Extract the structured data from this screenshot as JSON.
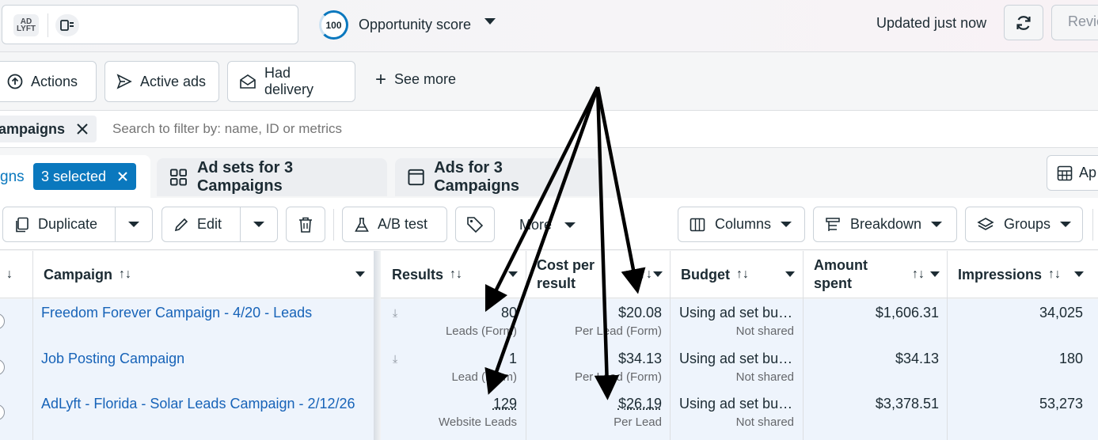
{
  "header": {
    "account_logo_text": "AD LYFT",
    "score_value": "100",
    "score_label": "Opportunity score",
    "updated_text": "Updated just now",
    "review_label": "Revie"
  },
  "filters": {
    "actions": "Actions",
    "active_ads": "Active ads",
    "had_delivery": "Had delivery",
    "see_more": "See more"
  },
  "search": {
    "chip_label": "ampaigns",
    "placeholder": "Search to filter by: name, ID or metrics"
  },
  "tabs": {
    "campaigns_partial": "gns",
    "selected_pill": "3 selected",
    "ad_sets": "Ad sets for 3 Campaigns",
    "ads": "Ads for 3 Campaigns",
    "apply_partial": "Ap"
  },
  "toolbar": {
    "duplicate": "Duplicate",
    "edit": "Edit",
    "ab_test": "A/B test",
    "more": "More",
    "columns": "Columns",
    "breakdown": "Breakdown",
    "groups": "Groups"
  },
  "table": {
    "headers": {
      "campaign": "Campaign",
      "results": "Results",
      "cost_per_result_1": "Cost per",
      "cost_per_result_2": "result",
      "budget": "Budget",
      "amount_spent_1": "Amount",
      "amount_spent_2": "spent",
      "impressions": "Impressions",
      "sort_symbol": "↑↓"
    },
    "rows": [
      {
        "campaign": "Freedom Forever Campaign - 4/20 - Leads",
        "results": "80",
        "results_sub": "Leads (Form)",
        "cost": "$20.08",
        "cost_sub": "Per Lead (Form)",
        "budget": "Using ad set bu…",
        "budget_sub": "Not shared",
        "spent": "$1,606.31",
        "impressions": "34,025"
      },
      {
        "campaign": "Job Posting Campaign",
        "results": "1",
        "results_sub": "Lead (Form)",
        "cost": "$34.13",
        "cost_sub": "Per Lead (Form)",
        "budget": "Using ad set bu…",
        "budget_sub": "Not shared",
        "spent": "$34.13",
        "impressions": "180"
      },
      {
        "campaign": "AdLyft - Florida - Solar Leads Campaign - 2/12/26",
        "results": "129",
        "results_sub": "Website Leads",
        "cost": "$26.19",
        "cost_sub": "Per Lead",
        "budget": "Using ad set bu…",
        "budget_sub": "Not shared",
        "spent": "$3,378.51",
        "impressions": "53,273"
      }
    ]
  },
  "colors": {
    "accent": "#0a78be",
    "link": "#1763b8",
    "row_selected": "#eef4fc",
    "annotation_arrow": "#000000"
  }
}
